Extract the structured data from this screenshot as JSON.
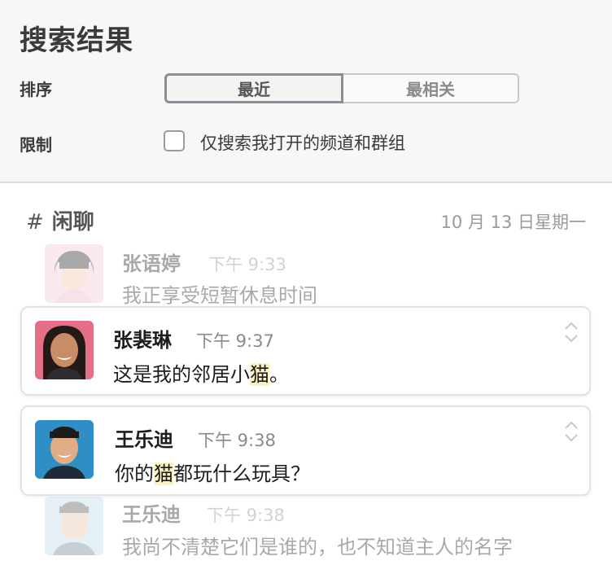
{
  "header": {
    "title": "搜索结果",
    "sort_label": "排序",
    "sort_options": [
      "最近",
      "最相关"
    ],
    "sort_selected": "最近",
    "limit_label": "限制",
    "limit_checkbox_label": "仅搜索我打开的频道和群组",
    "limit_checked": false
  },
  "channel": {
    "name": "闲聊",
    "date": "10 月 13 日星期一"
  },
  "messages": [
    {
      "name": "张语婷",
      "time": "下午 9:33",
      "text": "我正享受短暂休息时间",
      "faded": true
    },
    {
      "name": "张裴琳",
      "time": "下午 9:37",
      "text_before": "这是我的邻居小",
      "highlight": "猫",
      "text_after": "。",
      "faded": false
    },
    {
      "name": "王乐迪",
      "time": "下午 9:38",
      "text_before": "你的",
      "highlight": "猫",
      "text_after": "都玩什么玩具？",
      "faded": false
    },
    {
      "name": "王乐迪",
      "time": "下午 9:38",
      "text": "我尚不清楚它们是谁的，也不知道主人的名字",
      "faded": true
    }
  ],
  "colors": {
    "highlight": "#fdf2c2",
    "card_border": "#e2e2e2",
    "header_bg": "#f8f7f5"
  }
}
